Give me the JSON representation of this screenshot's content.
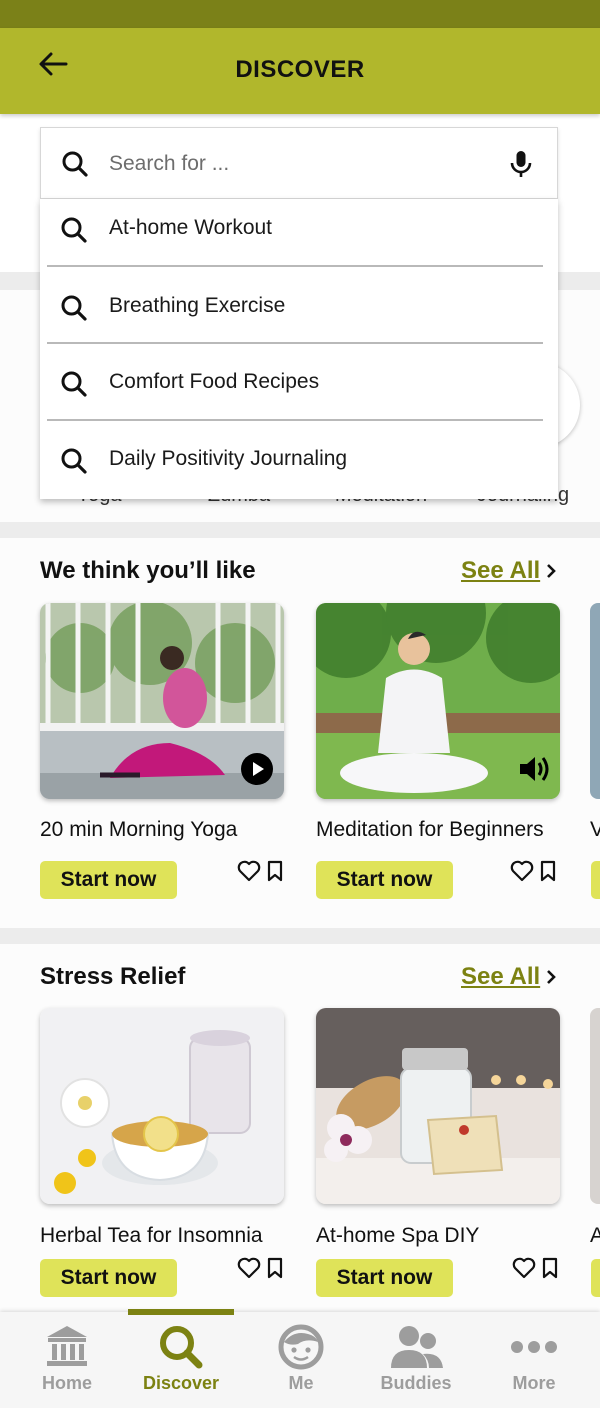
{
  "header": {
    "title": "DISCOVER"
  },
  "search": {
    "placeholder": "Search for ...",
    "suggestions": [
      {
        "label": "At-home Workout"
      },
      {
        "label": "Breathing Exercise"
      },
      {
        "label": "Comfort Food Recipes"
      },
      {
        "label": "Daily Positivity Journaling"
      }
    ]
  },
  "categories": {
    "partial_labels": [
      "Yoga",
      "Zumba",
      "Meditation",
      "Journaling"
    ]
  },
  "recommended": {
    "title": "We think you’ll like",
    "see_all": "See All",
    "cards": [
      {
        "title": "20 min Morning Yoga",
        "button": "Start now",
        "media_icon": "play-icon"
      },
      {
        "title": "Meditation for Beginners",
        "button": "Start now",
        "media_icon": "volume-icon"
      }
    ],
    "peek_title_char": "V"
  },
  "stress_relief": {
    "title": "Stress Relief",
    "see_all": "See All",
    "cards": [
      {
        "title": "Herbal Tea for Insomnia",
        "button": "Start now"
      },
      {
        "title": "At-home Spa DIY",
        "button": "Start now"
      }
    ],
    "peek_title_char": "A"
  },
  "nav": {
    "items": [
      {
        "label": "Home",
        "icon": "bank-icon"
      },
      {
        "label": "Discover",
        "icon": "search-icon",
        "active": true
      },
      {
        "label": "Me",
        "icon": "face-icon"
      },
      {
        "label": "Buddies",
        "icon": "people-icon"
      },
      {
        "label": "More",
        "icon": "more-dots-icon"
      }
    ]
  },
  "colors": {
    "header": "#b1b72c",
    "status_bar": "#7b8118",
    "accent": "#7c8212",
    "button": "#dfe359"
  }
}
